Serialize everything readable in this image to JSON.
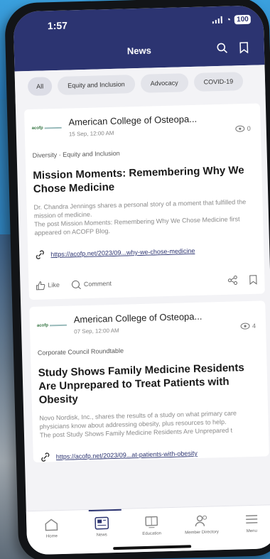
{
  "status": {
    "time": "1:57",
    "battery": "100"
  },
  "nav": {
    "title": "News"
  },
  "chips": [
    {
      "label": "All"
    },
    {
      "label": "Equity and Inclusion"
    },
    {
      "label": "Advocacy"
    },
    {
      "label": "COVID-19"
    }
  ],
  "posts": [
    {
      "org": "American College of Osteopa...",
      "date": "15 Sep, 12:00 AM",
      "views": "0",
      "tags": "Diversity · Equity and Inclusion",
      "headline": "Mission Moments: Remembering Why We Chose Medicine",
      "excerpt": "Dr. Chandra Jennings shares a personal story of a moment that fulfilled the mission of medicine.\nThe post Mission Moments: Remembering Why We Chose Medicine first appeared on ACOFP Blog.",
      "url": "https://acofp.net/2023/09...why-we-chose-medicine",
      "like": "Like",
      "comment": "Comment"
    },
    {
      "org": "American College of Osteopa...",
      "date": "07 Sep, 12:00 AM",
      "views": "4",
      "tags": "Corporate Council Roundtable",
      "headline": "Study Shows Family Medicine Residents Are Unprepared to Treat Patients with Obesity",
      "excerpt": "Novo Nordisk, Inc., shares the results of a study on what primary care physicians know about addressing obesity, plus resources to help.\nThe post Study Shows Family Medicine Residents Are Unprepared t",
      "url": "https://acofp.net/2023/09...at-patients-with-obesity"
    }
  ],
  "tabs": [
    {
      "label": "Home"
    },
    {
      "label": "News"
    },
    {
      "label": "Education"
    },
    {
      "label": "Member Directory"
    },
    {
      "label": "Menu"
    }
  ],
  "colors": {
    "nav": "#2c3471",
    "background": "#f3f3f6"
  }
}
